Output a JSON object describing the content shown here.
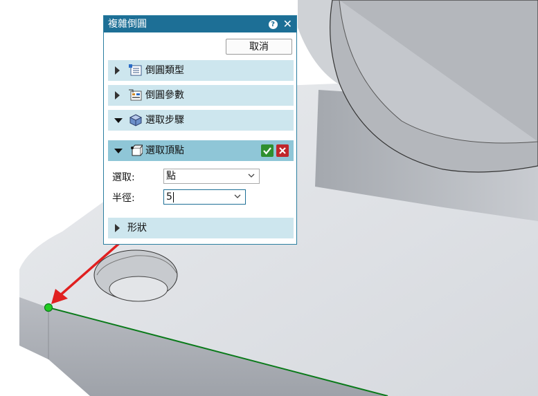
{
  "dialog": {
    "title": "複雜倒圓",
    "cancel_label": "取消",
    "sections": [
      {
        "label": "倒圓類型",
        "expanded": false,
        "icon": "fillet-type-icon"
      },
      {
        "label": "倒圓參數",
        "expanded": false,
        "icon": "fillet-params-icon"
      },
      {
        "label": "選取步驟",
        "expanded": true,
        "icon": "cube-icon"
      },
      {
        "label": "選取頂點",
        "expanded": true,
        "icon": "vertex-select-icon"
      },
      {
        "label": "形狀",
        "expanded": false,
        "icon": ""
      }
    ],
    "fields": {
      "select_label": "選取:",
      "select_value": "點",
      "radius_label": "半徑:",
      "radius_value": "5"
    }
  },
  "colors": {
    "title_bar": "#1d6f96",
    "section_bg": "#cde6ee",
    "section_active_bg": "#8fc6d7",
    "edge_highlight": "#0a7a1a",
    "annotation_arrow": "#e02020",
    "vertex_point": "#22cc22"
  }
}
